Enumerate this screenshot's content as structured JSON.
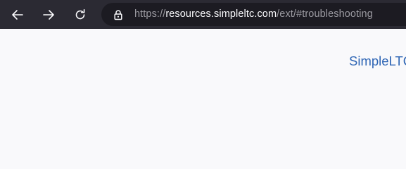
{
  "browser": {
    "url": {
      "scheme": "https://",
      "host": "resources.simpleltc.com",
      "path": "/ext/#troubleshooting"
    },
    "icons": {
      "back": "arrow-left-icon",
      "forward": "arrow-right-icon",
      "reload": "reload-icon",
      "lock": "lock-icon"
    }
  },
  "page": {
    "brand_text": "SimpleLTC"
  },
  "colors": {
    "toolbar_bg": "#2b2a33",
    "urlbar_bg": "#1c1b22",
    "page_bg": "#f9f9fb",
    "brand": "#2f66b5"
  }
}
